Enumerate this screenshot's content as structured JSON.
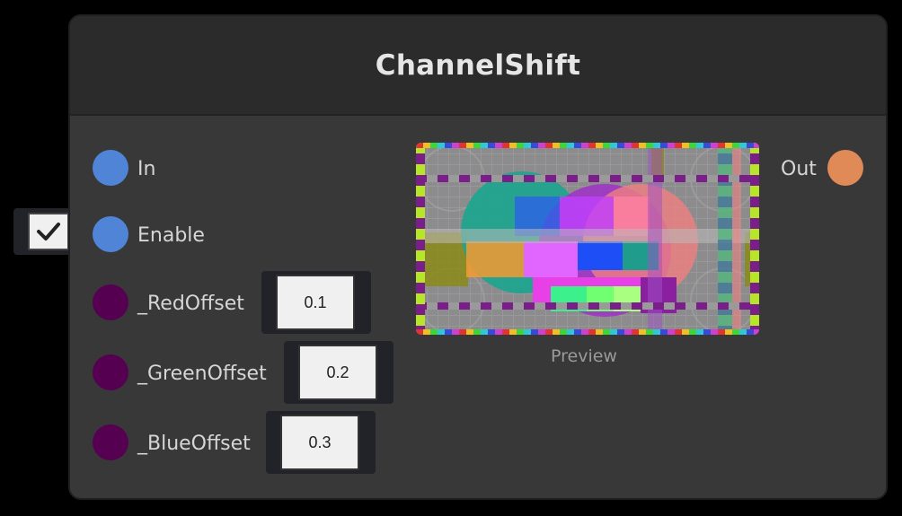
{
  "node": {
    "title": "ChannelShift"
  },
  "inputs": [
    {
      "label": "In",
      "color": "#4f84d6"
    },
    {
      "label": "Enable",
      "color": "#4f84d6",
      "checked": true
    },
    {
      "label": "_RedOffset",
      "color": "#560052",
      "value": "0.1"
    },
    {
      "label": "_GreenOffset",
      "color": "#560052",
      "value": "0.2"
    },
    {
      "label": "_BlueOffset",
      "color": "#560052",
      "value": "0.3"
    }
  ],
  "outputs": [
    {
      "label": "Out",
      "color": "#e08a57"
    }
  ],
  "preview": {
    "label": "Preview"
  },
  "icons": {
    "checkbox": "checkmark-icon"
  }
}
